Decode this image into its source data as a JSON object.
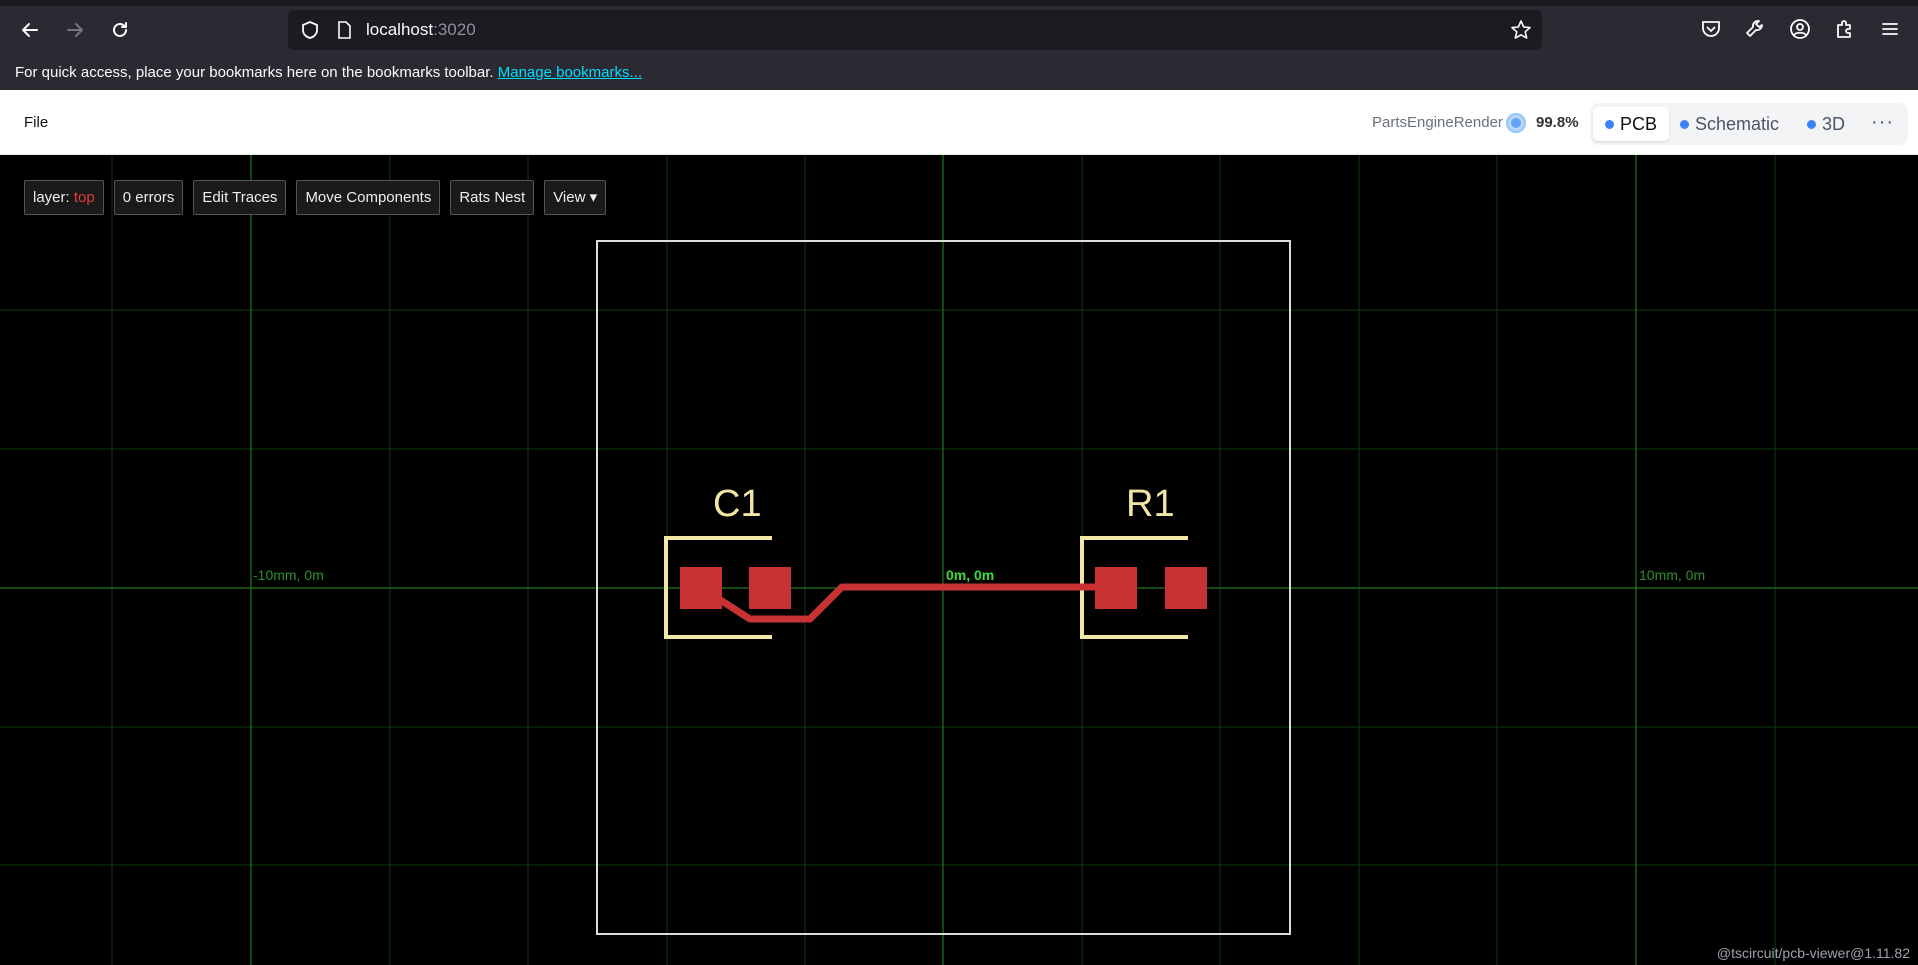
{
  "browser": {
    "url_host": "localhost",
    "url_port": ":3020",
    "bookmarks_text": "For quick access, place your bookmarks here on the bookmarks toolbar.",
    "bookmarks_link": "Manage bookmarks..."
  },
  "app": {
    "file_menu": "File",
    "engine_label": "PartsEngineRender",
    "engine_pct": "99.8%",
    "tabs": [
      {
        "label": "PCB",
        "active": true
      },
      {
        "label": "Schematic",
        "active": false
      },
      {
        "label": "3D",
        "active": false
      }
    ],
    "more": "···"
  },
  "pcb": {
    "layer_label": "layer:",
    "layer_value": "top",
    "errors": "0 errors",
    "edit_traces": "Edit Traces",
    "move_components": "Move Components",
    "rats_nest": "Rats Nest",
    "view": "View ▾",
    "coord_left": "-10mm, 0m",
    "coord_center": "0m, 0m",
    "coord_right": "10mm, 0m",
    "ref_c1": "C1",
    "ref_r1": "R1",
    "version": "@tscircuit/pcb-viewer@1.11.82"
  },
  "colors": {
    "pad": "#c83232",
    "silkscreen": "#f2e6a3",
    "grid": "#0c3a0c",
    "grid_major": "#1c7a1c",
    "board_outline": "#dddddd"
  }
}
